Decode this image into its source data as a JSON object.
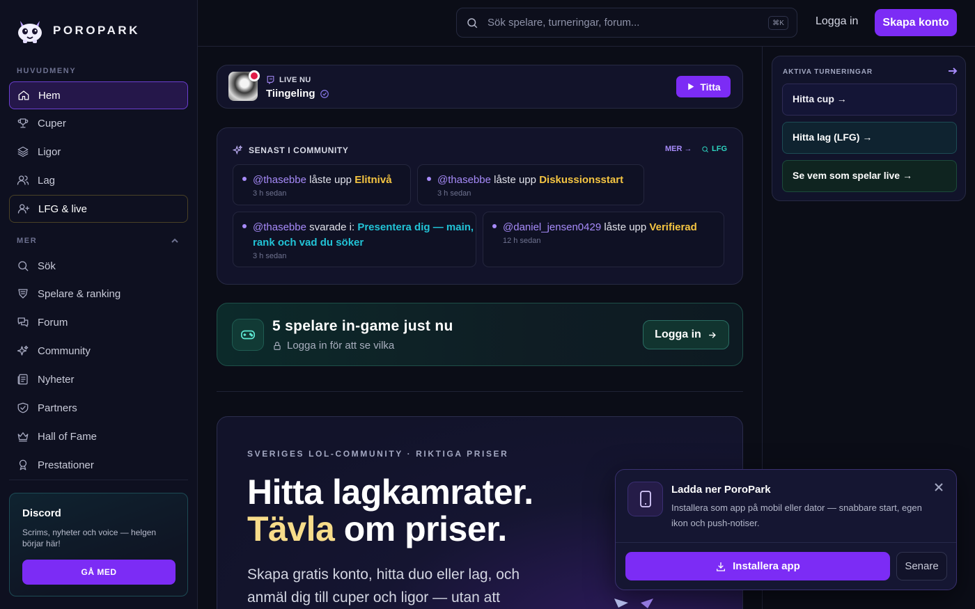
{
  "brand": {
    "name": "POROPARK"
  },
  "sidebar": {
    "main_title": "HUVUDMENY",
    "main_items": [
      {
        "label": "Hem",
        "icon": "home-icon"
      },
      {
        "label": "Cuper",
        "icon": "trophy-icon"
      },
      {
        "label": "Ligor",
        "icon": "layers-icon"
      },
      {
        "label": "Lag",
        "icon": "users-icon"
      },
      {
        "label": "LFG & live",
        "icon": "user-plus-icon"
      }
    ],
    "more_title": "MER",
    "more_items": [
      {
        "label": "Sök",
        "icon": "search-icon"
      },
      {
        "label": "Spelare & ranking",
        "icon": "ranking-icon"
      },
      {
        "label": "Forum",
        "icon": "chat-icon"
      },
      {
        "label": "Community",
        "icon": "sparkles-icon"
      },
      {
        "label": "Nyheter",
        "icon": "newspaper-icon"
      },
      {
        "label": "Partners",
        "icon": "handshake-icon"
      },
      {
        "label": "Hall of Fame",
        "icon": "crown-icon"
      },
      {
        "label": "Prestationer",
        "icon": "award-icon"
      }
    ],
    "discord": {
      "title": "Discord",
      "desc": "Scrims, nyheter och voice — helgen börjar här!",
      "button": "GÅ MED"
    }
  },
  "topbar": {
    "search_placeholder": "Sök spelare, turneringar, forum...",
    "shortcut": "⌘K",
    "login": "Logga in",
    "signup": "Skapa konto"
  },
  "live": {
    "label": "LIVE NU",
    "name": "Tiingeling",
    "watch": "Titta"
  },
  "community": {
    "title": "SENAST I COMMUNITY",
    "more": "MER →",
    "lfg": "LFG",
    "activities": [
      {
        "user": "@thasebbe",
        "verb": "låste upp",
        "target": "Elitnivå",
        "time": "3 h sedan"
      },
      {
        "user": "@thasebbe",
        "verb": "låste upp",
        "target": "Diskussionsstart",
        "time": "3 h sedan"
      },
      {
        "user": "@thasebbe",
        "verb": "svarade i:",
        "target": "Presentera dig — main, rank och vad du söker",
        "time": "3 h sedan"
      },
      {
        "user": "@daniel_jensen0429",
        "verb": "låste upp",
        "target": "Verifierad",
        "time": "12 h sedan"
      }
    ]
  },
  "ingame": {
    "title": "5 spelare in-game just nu",
    "subtitle": "Logga in för att se vilka",
    "button": "Logga in"
  },
  "hero": {
    "kicker": "SVERIGES LOL-COMMUNITY · RIKTIGA PRISER",
    "line1": "Hitta lagkamrater.",
    "line2_accent": "Tävla",
    "line2_rest": " om priser.",
    "paragraph": "Skapa gratis konto, hitta duo eller lag, och anmäl dig till cuper och ligor — utan att"
  },
  "tournaments": {
    "title": "AKTIVA TURNERINGAR",
    "links": [
      "Hitta cup →",
      "Hitta lag (LFG) →",
      "Se vem som spelar live →"
    ]
  },
  "install": {
    "title": "Ladda ner PoroPark",
    "desc": "Installera som app på mobil eller dator — snabbare start, egen ikon och push-notiser.",
    "install_btn": "Installera app",
    "later_btn": "Senare"
  },
  "colors": {
    "accent": "#7c2cf5",
    "gold": "#f5c542",
    "teal": "#2dd4bf",
    "background": "#0b0d17"
  }
}
